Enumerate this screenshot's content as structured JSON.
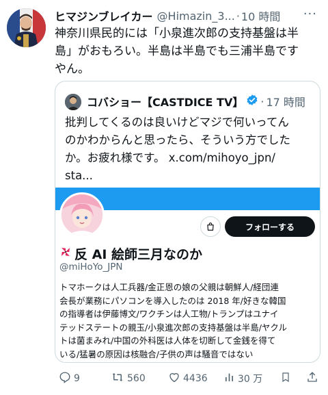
{
  "tweet": {
    "author_name": "ヒマジンブレイカー",
    "author_handle": "@Himazin_3...",
    "dot": "·",
    "time": "10 時間",
    "more": "···",
    "lines": [
      "神奈川県民的には「小泉進次郎の支持基盤は半",
      "島」がおもろい。半島は半島でも三浦半島です",
      "やん。"
    ]
  },
  "quote": {
    "author_name": "コバショー【CASTDICE TV】",
    "dot": "·",
    "time": "17 時間",
    "lines": [
      "批判してくるのは良いけどマジで何いってん",
      "のかわからんと思ったら、そういう方でした",
      "か。お疲れ様です。 x.com/mihoyo_jpn/",
      "sta..."
    ],
    "card": {
      "follow_label": "フォローする",
      "display_name": "反 AI 絵師三月なのか",
      "handle": "@miHoYo_JPN",
      "bio_lines": [
        "トマホークは人工兵器/金正恩の娘の父親は朝鮮人/経団連",
        "会長が業務にパソコンを導入したのは 2018 年/好きな韓国",
        "の指導者は伊藤博文/ワクチンは人工物/トランプはユナイ",
        "テッドステートの親玉/小泉進次郎の支持基盤は半島/ヤクル",
        "トは菌まみれ/中国の外科医は人体を切断して金銭を得て",
        "いる/猛暑の原因は核融合/子供の声は騒音ではない"
      ]
    }
  },
  "actions": {
    "replies": "9",
    "reposts": "560",
    "likes": "4436",
    "views": "30 万"
  },
  "colors": {
    "accent": "#1d9bf0",
    "text": "#0f1419",
    "muted": "#536471",
    "border": "#cfd9de"
  },
  "icons": [
    "verified-badge-icon",
    "reply-icon",
    "repost-icon",
    "like-icon",
    "views-icon",
    "bookmark-icon",
    "share-icon",
    "shopping-bag-icon",
    "pinwheel-emoji-icon"
  ]
}
